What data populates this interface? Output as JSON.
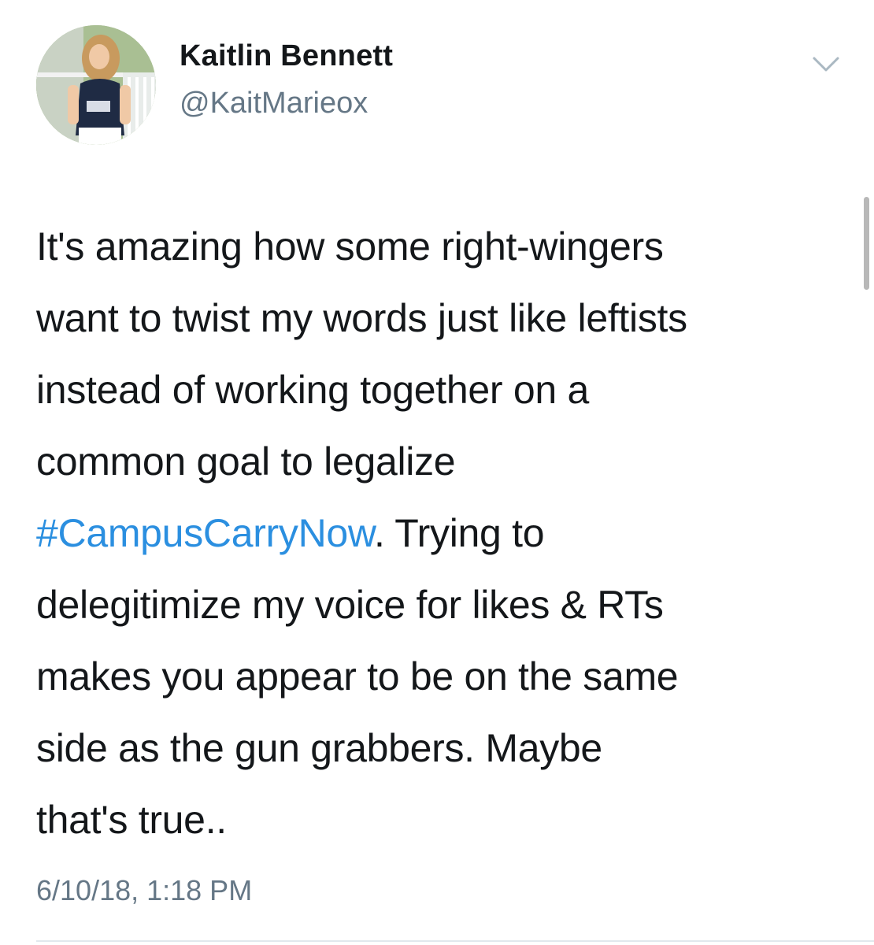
{
  "user": {
    "name": "Kaitlin Bennett",
    "handle": "@KaitMarieox"
  },
  "tweet": {
    "lines": [
      [
        "It's amazing how some right-wingers"
      ],
      [
        "want to twist my words just like leftists"
      ],
      [
        "instead of working together on a"
      ],
      [
        "common goal to legalize"
      ],
      [
        "#CampusCarryNow",
        ". Trying to"
      ],
      [
        "delegitimize my voice for likes & RTs"
      ],
      [
        "makes you appear to be on the same"
      ],
      [
        "side as the gun grabbers. Maybe"
      ],
      [
        "that's true.."
      ]
    ],
    "timestamp": "6/10/18, 1:18 PM"
  },
  "colors": {
    "hashtag": "#2b8fe0",
    "name": "#14171a",
    "secondary": "#657786"
  },
  "icons": {
    "menu": "chevron-down-icon",
    "avatar": "profile-photo"
  }
}
